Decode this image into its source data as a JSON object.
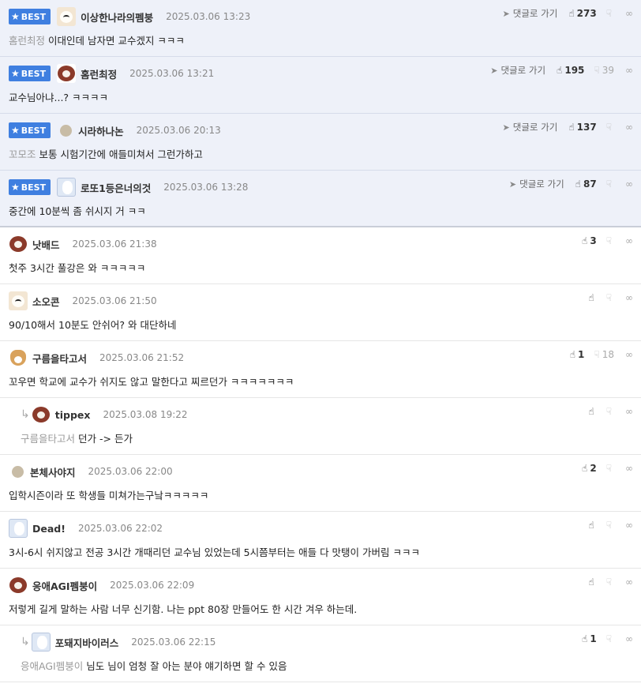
{
  "comments": [
    {
      "best": true,
      "avatar": "dog",
      "nick": "이상한나라의펨붕",
      "date": "2025.03.06 13:23",
      "mention": "홈런최정",
      "text": "이대인데 남자면 교수겠지 ㅋㅋㅋ",
      "goto": "댓글로 가기",
      "up": "273",
      "down": ""
    },
    {
      "best": true,
      "avatar": "red",
      "nick": "홈런최정",
      "date": "2025.03.06 13:21",
      "mention": "",
      "text": "교수님아냐...? ㅋㅋㅋㅋ",
      "goto": "댓글로 가기",
      "up": "195",
      "down": "39"
    },
    {
      "best": true,
      "avatar": "dot",
      "nick": "시라하나논",
      "date": "2025.03.06 20:13",
      "mention": "꼬모조",
      "text": "보통 시험기간에 애들미쳐서 그런가하고",
      "goto": "댓글로 가기",
      "up": "137",
      "down": ""
    },
    {
      "best": true,
      "avatar": "blue",
      "nick": "로또1등은너의것",
      "date": "2025.03.06 13:28",
      "mention": "",
      "text": "중간에 10분씩 좀 쉬시지 거 ㅋㅋ",
      "goto": "댓글로 가기",
      "up": "87",
      "down": ""
    },
    {
      "best": false,
      "avatar": "red",
      "nick": "낫배드",
      "date": "2025.03.06 21:38",
      "mention": "",
      "text": "첫주 3시간 풀강은 와 ㅋㅋㅋㅋㅋ",
      "up": "3",
      "down": ""
    },
    {
      "best": false,
      "avatar": "dog",
      "nick": "소오콘",
      "date": "2025.03.06 21:50",
      "mention": "",
      "text": "90/10해서 10분도 안쉬어? 와 대단하네",
      "up": "",
      "down": ""
    },
    {
      "best": false,
      "avatar": "fox",
      "nick": "구름을타고서",
      "date": "2025.03.06 21:52",
      "mention": "",
      "text": "꼬우면 학교에 교수가 쉬지도 않고 말한다고 찌르던가 ㅋㅋㅋㅋㅋㅋㅋ",
      "up": "1",
      "down": "18"
    },
    {
      "best": false,
      "reply": true,
      "avatar": "red",
      "nick": "tippex",
      "date": "2025.03.08 19:22",
      "mention": "구름을타고서",
      "text": "던가 -> 든가",
      "up": "",
      "down": ""
    },
    {
      "best": false,
      "avatar": "dot",
      "nick": "본체사야지",
      "date": "2025.03.06 22:00",
      "mention": "",
      "text": "입학시즌이라 또 학생들 미쳐가는구낰ㅋㅋㅋㅋㅋ",
      "up": "2",
      "down": ""
    },
    {
      "best": false,
      "avatar": "blue",
      "nick": "Dead!",
      "date": "2025.03.06 22:02",
      "mention": "",
      "text": "3시-6시 쉬지않고 전공 3시간 개때리던 교수님 있었는데 5시쯤부터는 애들 다 맛탱이 가버림 ㅋㅋㅋ",
      "up": "",
      "down": ""
    },
    {
      "best": false,
      "avatar": "red",
      "nick": "응애AGI펨붕이",
      "date": "2025.03.06 22:09",
      "mention": "",
      "text": "저렇게 길게 말하는 사람 너무 신기함. 나는 ppt 80장 만들어도 한 시간 겨우 하는데.",
      "up": "",
      "down": ""
    },
    {
      "best": false,
      "reply": true,
      "avatar": "blue",
      "nick": "포돼지바이러스",
      "date": "2025.03.06 22:15",
      "mention": "응애AGI펨붕이",
      "text": "님도 님이 엄청 잘 아는 분야 얘기하면 할 수 있음",
      "up": "1",
      "down": ""
    }
  ],
  "labels": {
    "best": "BEST"
  },
  "icons": {
    "best": "star-icon",
    "goto": "paper-plane-icon",
    "up": "thumbs-up-icon",
    "down": "thumbs-down-icon",
    "link": "link-icon",
    "reply": "reply-arrow-icon"
  },
  "colors": {
    "best_badge": "#3f7fe0",
    "best_bg": "#eef1f9"
  }
}
